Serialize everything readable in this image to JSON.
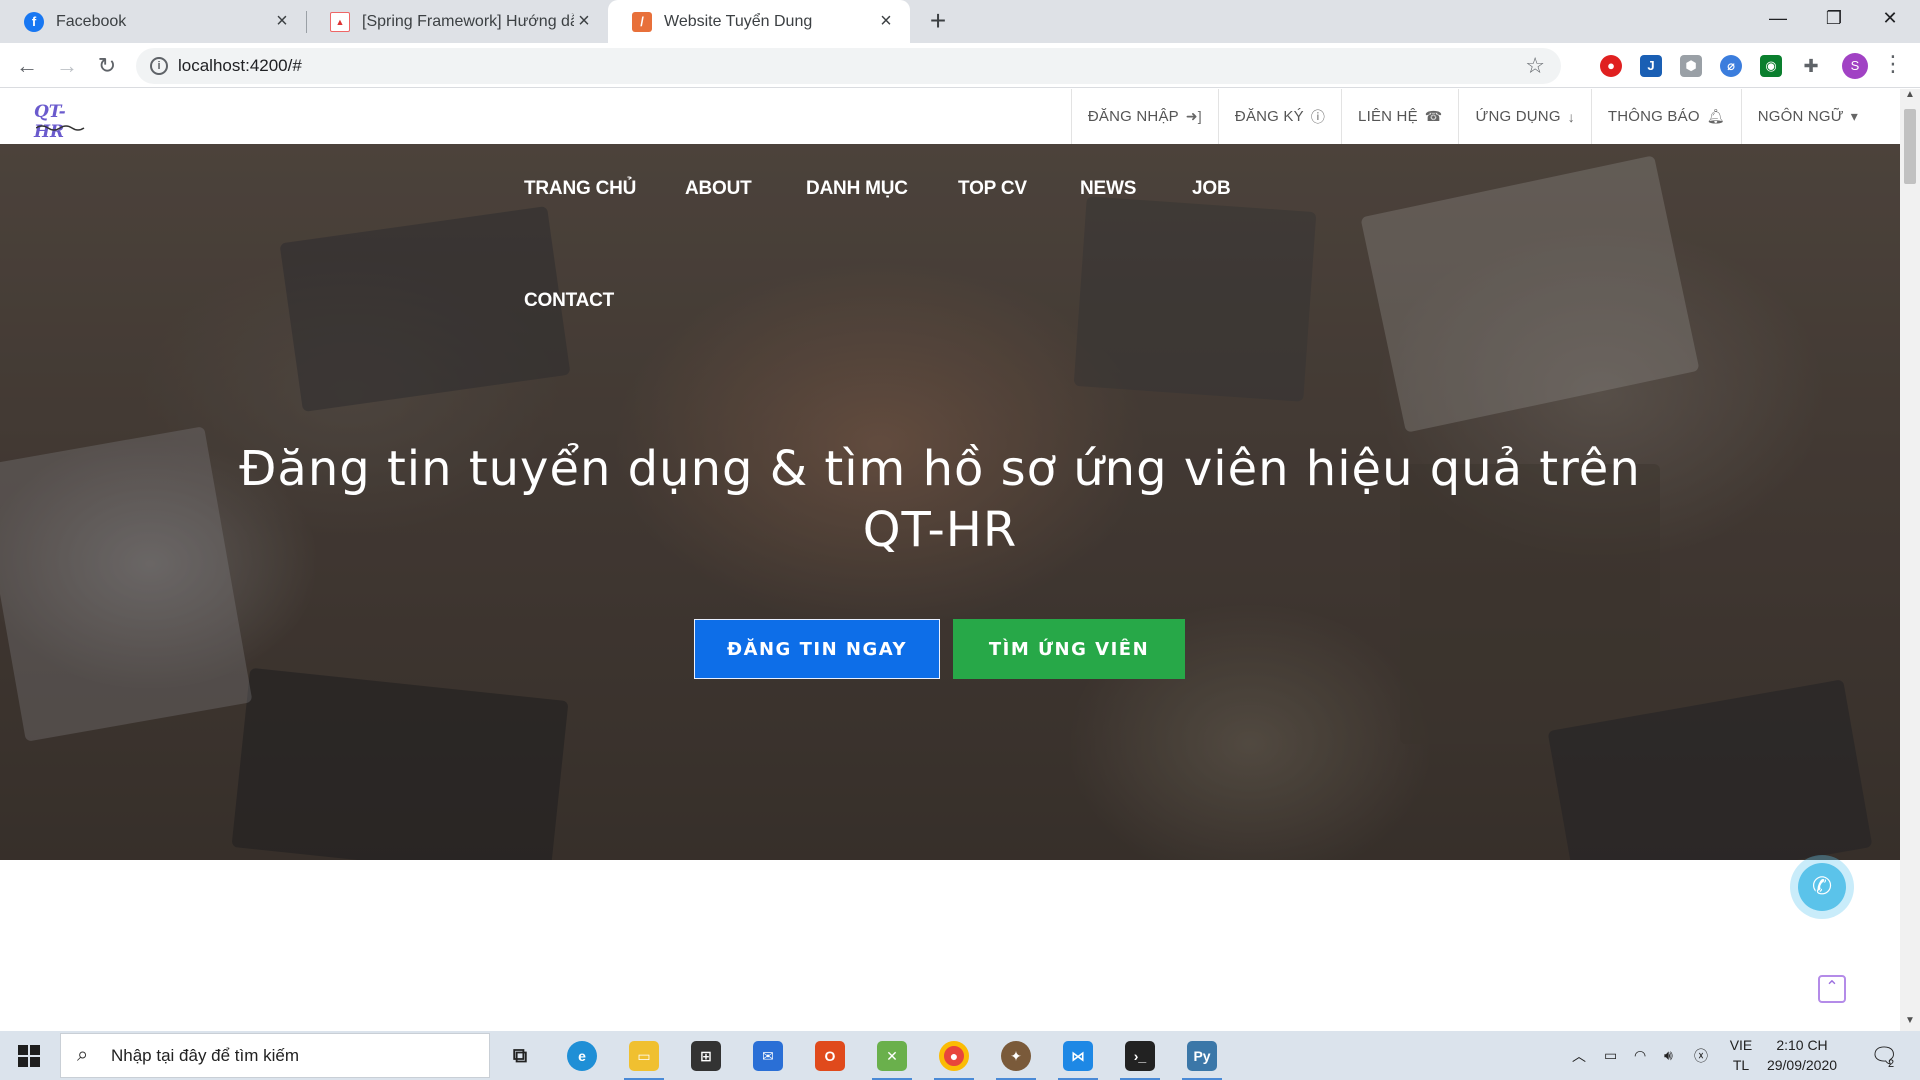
{
  "browser": {
    "tabs": [
      {
        "title": "Facebook",
        "icon": "facebook-icon",
        "active": false
      },
      {
        "title": "[Spring Framework] Hướng dẫn t",
        "icon": "site-icon",
        "active": false
      },
      {
        "title": "Website Tuyển Dung",
        "icon": "angular-icon",
        "active": true
      }
    ],
    "url": "localhost:4200/#",
    "profile_initial": "S"
  },
  "site": {
    "logo_text": "QT-HR",
    "topmenu": [
      {
        "label": "ĐĂNG NHẬP",
        "icon": "login-icon"
      },
      {
        "label": "ĐĂNG KÝ",
        "icon": "info-icon"
      },
      {
        "label": "LIÊN HỆ",
        "icon": "phone-icon"
      },
      {
        "label": "ỨNG DỤNG",
        "icon": "download-icon"
      },
      {
        "label": "THÔNG BÁO",
        "icon": "bell-icon"
      },
      {
        "label": "NGÔN NGỮ",
        "icon": "caret-down-icon"
      }
    ],
    "mainnav": [
      "TRANG CHỦ",
      "ABOUT",
      "DANH MỤC",
      "TOP CV",
      "NEWS",
      "JOB",
      "CONTACT"
    ],
    "headline": "Đăng tin tuyển dụng & tìm hồ sơ ứng viên hiệu quả trên QT-HR",
    "btn_post": "ĐĂNG TIN NGAY",
    "btn_find": "TÌM ỨNG VIÊN",
    "colors": {
      "primary_button": "#0d6ee8",
      "success_button": "#27a848"
    }
  },
  "taskbar": {
    "search_placeholder": "Nhập tại đây để tìm kiếm",
    "lang_line1": "VIE",
    "lang_line2": "TL",
    "time": "2:10 CH",
    "date": "29/09/2020",
    "notification_count": "2"
  }
}
